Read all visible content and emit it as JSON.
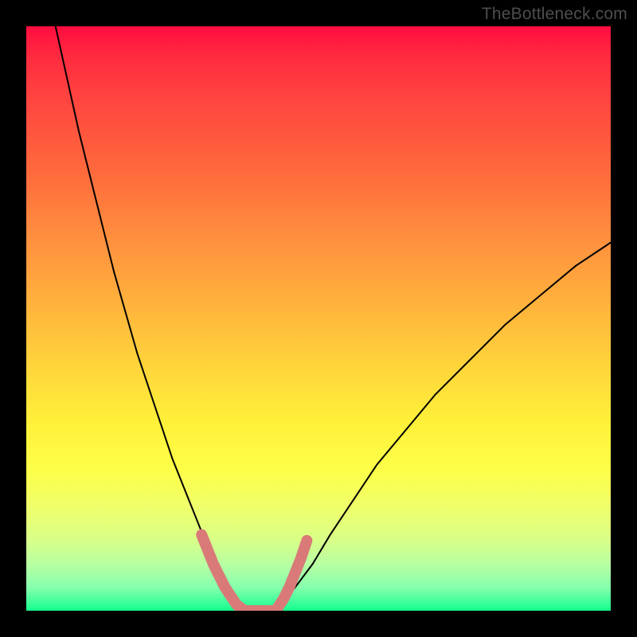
{
  "watermark": "TheBottleneck.com",
  "chart_data": {
    "type": "line",
    "title": "",
    "xlabel": "",
    "ylabel": "",
    "xlim": [
      0,
      100
    ],
    "ylim": [
      0,
      100
    ],
    "legend": false,
    "grid": false,
    "background": {
      "gradient_direction": "vertical",
      "top_color": "#ff0c3f",
      "bottom_color": "#14ff8e",
      "note": "red→orange→yellow→green top-to-bottom gradient"
    },
    "series": [
      {
        "name": "left-curve",
        "stroke": "#000000",
        "x": [
          5,
          7,
          9,
          11,
          13,
          15,
          17,
          19,
          21,
          23,
          25,
          27,
          29,
          31,
          33,
          34,
          36,
          38
        ],
        "y": [
          100,
          91,
          82,
          74,
          66,
          58,
          51,
          44,
          38,
          32,
          26,
          21,
          16,
          11,
          7,
          4,
          1.5,
          0
        ]
      },
      {
        "name": "right-curve",
        "stroke": "#000000",
        "x": [
          42,
          44,
          46,
          49,
          52,
          56,
          60,
          65,
          70,
          76,
          82,
          88,
          94,
          100
        ],
        "y": [
          0,
          1.5,
          4,
          8,
          13,
          19,
          25,
          31,
          37,
          43,
          49,
          54,
          59,
          63
        ]
      },
      {
        "name": "marker-band",
        "stroke": "#d97a79",
        "note": "thick salmon-pink stroke near the valley",
        "segments": [
          {
            "x": [
              30,
              31,
              32,
              33,
              34,
              35,
              36,
              37
            ],
            "y": [
              13,
              10.5,
              8,
              6,
              4,
              2.5,
              1,
              0.3
            ]
          },
          {
            "x": [
              37,
              38,
              39,
              40,
              41,
              42,
              43
            ],
            "y": [
              0,
              0,
              0,
              0,
              0,
              0,
              0
            ]
          },
          {
            "x": [
              43,
              44,
              45,
              46,
              47,
              48
            ],
            "y": [
              0.5,
              2,
              4,
              6.5,
              9,
              12
            ]
          }
        ]
      }
    ]
  }
}
